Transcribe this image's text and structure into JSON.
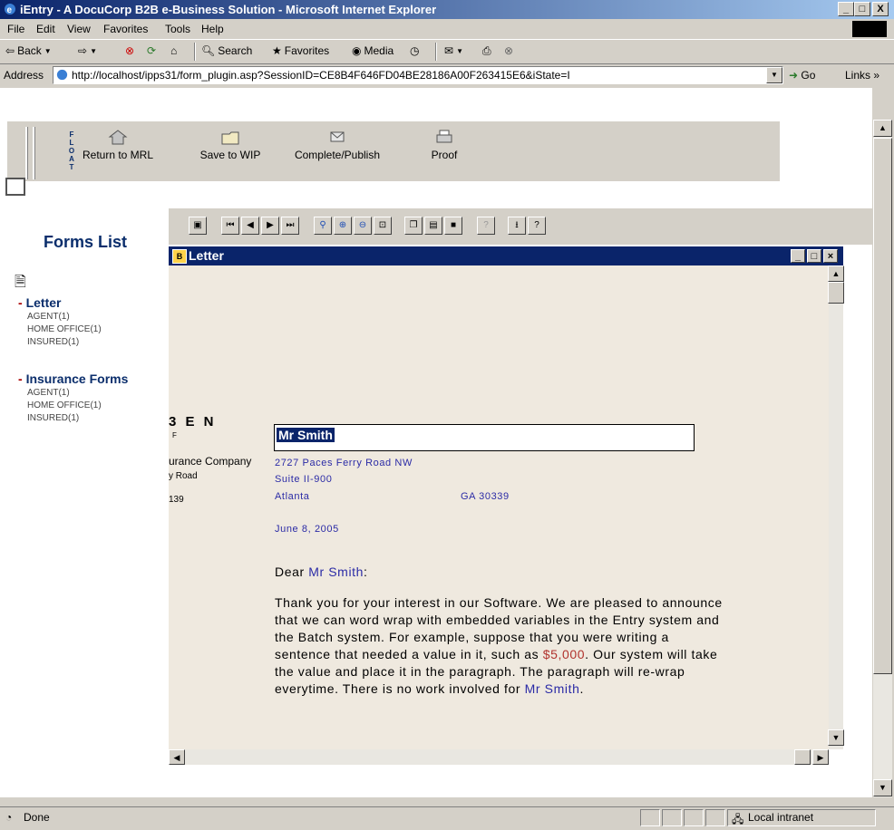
{
  "window": {
    "title": "iEntry - A DocuCorp B2B e-Business Solution - Microsoft Internet Explorer",
    "controls": [
      "_",
      "□",
      "X"
    ]
  },
  "menu": [
    "File",
    "Edit",
    "View",
    "Favorites",
    "Tools",
    "Help"
  ],
  "toolbar": {
    "back": "Back",
    "search": "Search",
    "favorites": "Favorites",
    "media": "Media"
  },
  "address": {
    "label": "Address",
    "url": "http://localhost/ipps31/form_plugin.asp?SessionID=CE8B4F646FD04BE28186A00F263415E6&iState=I",
    "go": "Go",
    "links": "Links"
  },
  "plugin_toolbar": {
    "float_letters": [
      "F",
      "L",
      "O",
      "A",
      "T"
    ],
    "return": "Return to MRL",
    "save": "Save to WIP",
    "complete": "Complete/Publish",
    "proof": "Proof"
  },
  "forms_list": {
    "title": "Forms List",
    "groups": [
      {
        "name": "Letter",
        "items": [
          "AGENT(1)",
          "HOME OFFICE(1)",
          "INSURED(1)"
        ]
      },
      {
        "name": "Insurance Forms",
        "items": [
          "AGENT(1)",
          "HOME OFFICE(1)",
          "INSURED(1)"
        ]
      }
    ],
    "dash": "-"
  },
  "doc_window": {
    "title": "Letter",
    "fragments": {
      "frag1": "3 E N",
      "frag2": "F",
      "frag3": "urance Company",
      "frag4": "y Road",
      "frag5": "139"
    },
    "recipient": {
      "name_field": "Mr Smith",
      "address1": "2727 Paces Ferry Road NW",
      "address2": "Suite II-900",
      "city": "Atlanta",
      "state_zip": "GA   30339"
    },
    "date": "June 8, 2005",
    "salutation_prefix": "Dear ",
    "salutation_name": "Mr Smith",
    "salutation_suffix": ":",
    "body_lines": [
      "Thank you for your interest in our Software.  We are pleased to announce",
      "that we can word wrap with embedded variables in the Entry system and",
      "the Batch system.  For example, suppose that you were writing a"
    ],
    "line4_prefix": "sentence that needed a value in it, such as ",
    "line4_value": "$5,000",
    "line4_suffix": ". Our system will take",
    "line5": "the value and place it in the paragraph.  The paragraph will re-wrap",
    "line6_prefix": "everytime.  There is no work involved for ",
    "line6_name": "Mr Smith",
    "line6_suffix": "."
  },
  "status": {
    "left": "Done",
    "zone": "Local intranet"
  }
}
